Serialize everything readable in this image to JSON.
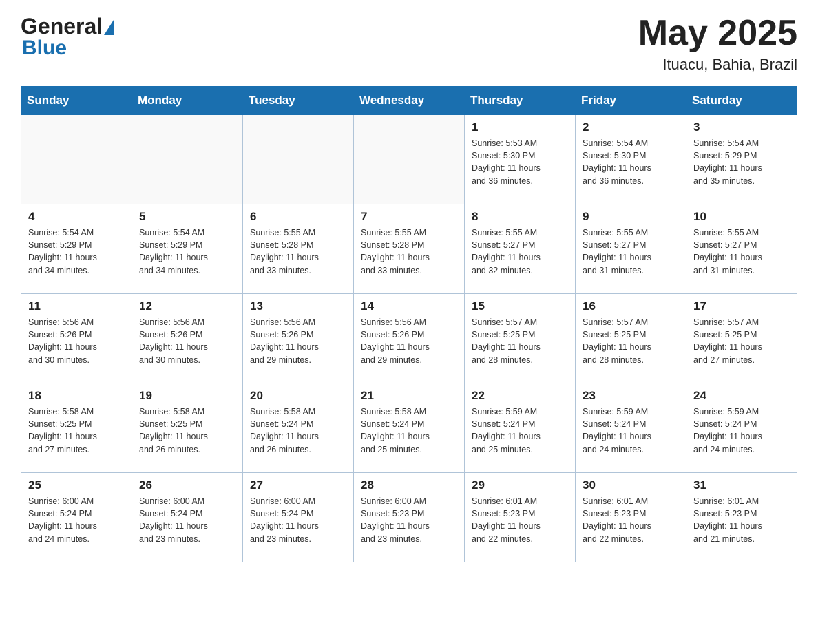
{
  "header": {
    "logo_general": "General",
    "logo_blue": "Blue",
    "month_year": "May 2025",
    "location": "Ituacu, Bahia, Brazil"
  },
  "days_of_week": [
    "Sunday",
    "Monday",
    "Tuesday",
    "Wednesday",
    "Thursday",
    "Friday",
    "Saturday"
  ],
  "weeks": [
    [
      {
        "num": "",
        "info": ""
      },
      {
        "num": "",
        "info": ""
      },
      {
        "num": "",
        "info": ""
      },
      {
        "num": "",
        "info": ""
      },
      {
        "num": "1",
        "info": "Sunrise: 5:53 AM\nSunset: 5:30 PM\nDaylight: 11 hours\nand 36 minutes."
      },
      {
        "num": "2",
        "info": "Sunrise: 5:54 AM\nSunset: 5:30 PM\nDaylight: 11 hours\nand 36 minutes."
      },
      {
        "num": "3",
        "info": "Sunrise: 5:54 AM\nSunset: 5:29 PM\nDaylight: 11 hours\nand 35 minutes."
      }
    ],
    [
      {
        "num": "4",
        "info": "Sunrise: 5:54 AM\nSunset: 5:29 PM\nDaylight: 11 hours\nand 34 minutes."
      },
      {
        "num": "5",
        "info": "Sunrise: 5:54 AM\nSunset: 5:29 PM\nDaylight: 11 hours\nand 34 minutes."
      },
      {
        "num": "6",
        "info": "Sunrise: 5:55 AM\nSunset: 5:28 PM\nDaylight: 11 hours\nand 33 minutes."
      },
      {
        "num": "7",
        "info": "Sunrise: 5:55 AM\nSunset: 5:28 PM\nDaylight: 11 hours\nand 33 minutes."
      },
      {
        "num": "8",
        "info": "Sunrise: 5:55 AM\nSunset: 5:27 PM\nDaylight: 11 hours\nand 32 minutes."
      },
      {
        "num": "9",
        "info": "Sunrise: 5:55 AM\nSunset: 5:27 PM\nDaylight: 11 hours\nand 31 minutes."
      },
      {
        "num": "10",
        "info": "Sunrise: 5:55 AM\nSunset: 5:27 PM\nDaylight: 11 hours\nand 31 minutes."
      }
    ],
    [
      {
        "num": "11",
        "info": "Sunrise: 5:56 AM\nSunset: 5:26 PM\nDaylight: 11 hours\nand 30 minutes."
      },
      {
        "num": "12",
        "info": "Sunrise: 5:56 AM\nSunset: 5:26 PM\nDaylight: 11 hours\nand 30 minutes."
      },
      {
        "num": "13",
        "info": "Sunrise: 5:56 AM\nSunset: 5:26 PM\nDaylight: 11 hours\nand 29 minutes."
      },
      {
        "num": "14",
        "info": "Sunrise: 5:56 AM\nSunset: 5:26 PM\nDaylight: 11 hours\nand 29 minutes."
      },
      {
        "num": "15",
        "info": "Sunrise: 5:57 AM\nSunset: 5:25 PM\nDaylight: 11 hours\nand 28 minutes."
      },
      {
        "num": "16",
        "info": "Sunrise: 5:57 AM\nSunset: 5:25 PM\nDaylight: 11 hours\nand 28 minutes."
      },
      {
        "num": "17",
        "info": "Sunrise: 5:57 AM\nSunset: 5:25 PM\nDaylight: 11 hours\nand 27 minutes."
      }
    ],
    [
      {
        "num": "18",
        "info": "Sunrise: 5:58 AM\nSunset: 5:25 PM\nDaylight: 11 hours\nand 27 minutes."
      },
      {
        "num": "19",
        "info": "Sunrise: 5:58 AM\nSunset: 5:25 PM\nDaylight: 11 hours\nand 26 minutes."
      },
      {
        "num": "20",
        "info": "Sunrise: 5:58 AM\nSunset: 5:24 PM\nDaylight: 11 hours\nand 26 minutes."
      },
      {
        "num": "21",
        "info": "Sunrise: 5:58 AM\nSunset: 5:24 PM\nDaylight: 11 hours\nand 25 minutes."
      },
      {
        "num": "22",
        "info": "Sunrise: 5:59 AM\nSunset: 5:24 PM\nDaylight: 11 hours\nand 25 minutes."
      },
      {
        "num": "23",
        "info": "Sunrise: 5:59 AM\nSunset: 5:24 PM\nDaylight: 11 hours\nand 24 minutes."
      },
      {
        "num": "24",
        "info": "Sunrise: 5:59 AM\nSunset: 5:24 PM\nDaylight: 11 hours\nand 24 minutes."
      }
    ],
    [
      {
        "num": "25",
        "info": "Sunrise: 6:00 AM\nSunset: 5:24 PM\nDaylight: 11 hours\nand 24 minutes."
      },
      {
        "num": "26",
        "info": "Sunrise: 6:00 AM\nSunset: 5:24 PM\nDaylight: 11 hours\nand 23 minutes."
      },
      {
        "num": "27",
        "info": "Sunrise: 6:00 AM\nSunset: 5:24 PM\nDaylight: 11 hours\nand 23 minutes."
      },
      {
        "num": "28",
        "info": "Sunrise: 6:00 AM\nSunset: 5:23 PM\nDaylight: 11 hours\nand 23 minutes."
      },
      {
        "num": "29",
        "info": "Sunrise: 6:01 AM\nSunset: 5:23 PM\nDaylight: 11 hours\nand 22 minutes."
      },
      {
        "num": "30",
        "info": "Sunrise: 6:01 AM\nSunset: 5:23 PM\nDaylight: 11 hours\nand 22 minutes."
      },
      {
        "num": "31",
        "info": "Sunrise: 6:01 AM\nSunset: 5:23 PM\nDaylight: 11 hours\nand 21 minutes."
      }
    ]
  ]
}
